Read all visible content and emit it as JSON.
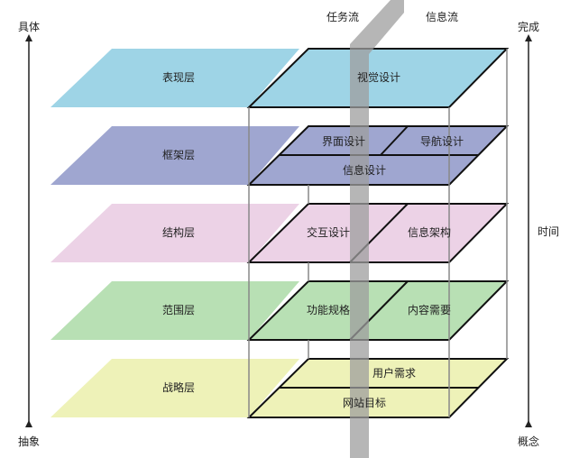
{
  "labels": {
    "concrete": "具体",
    "abstract": "抽象",
    "complete": "完成",
    "concept": "概念",
    "time": "时间",
    "task_flow": "任务流",
    "info_flow": "信息流"
  },
  "layers": [
    {
      "name": "表现层",
      "color": "#9ed4e6",
      "elements": [
        "视觉设计"
      ]
    },
    {
      "name": "框架层",
      "color": "#9fa6d0",
      "elements": [
        "界面设计",
        "导航设计",
        "信息设计"
      ]
    },
    {
      "name": "结构层",
      "color": "#ecd2e6",
      "elements": [
        "交互设计",
        "信息架构"
      ]
    },
    {
      "name": "范围层",
      "color": "#b8e0b4",
      "elements": [
        "功能规格",
        "内容需要"
      ]
    },
    {
      "name": "战略层",
      "color": "#eef2b8",
      "elements": [
        "用户需求",
        "网站目标"
      ]
    }
  ],
  "colors": {
    "divider_band": "#9e9e9e",
    "outline": "#111111",
    "frame": "#888888"
  }
}
